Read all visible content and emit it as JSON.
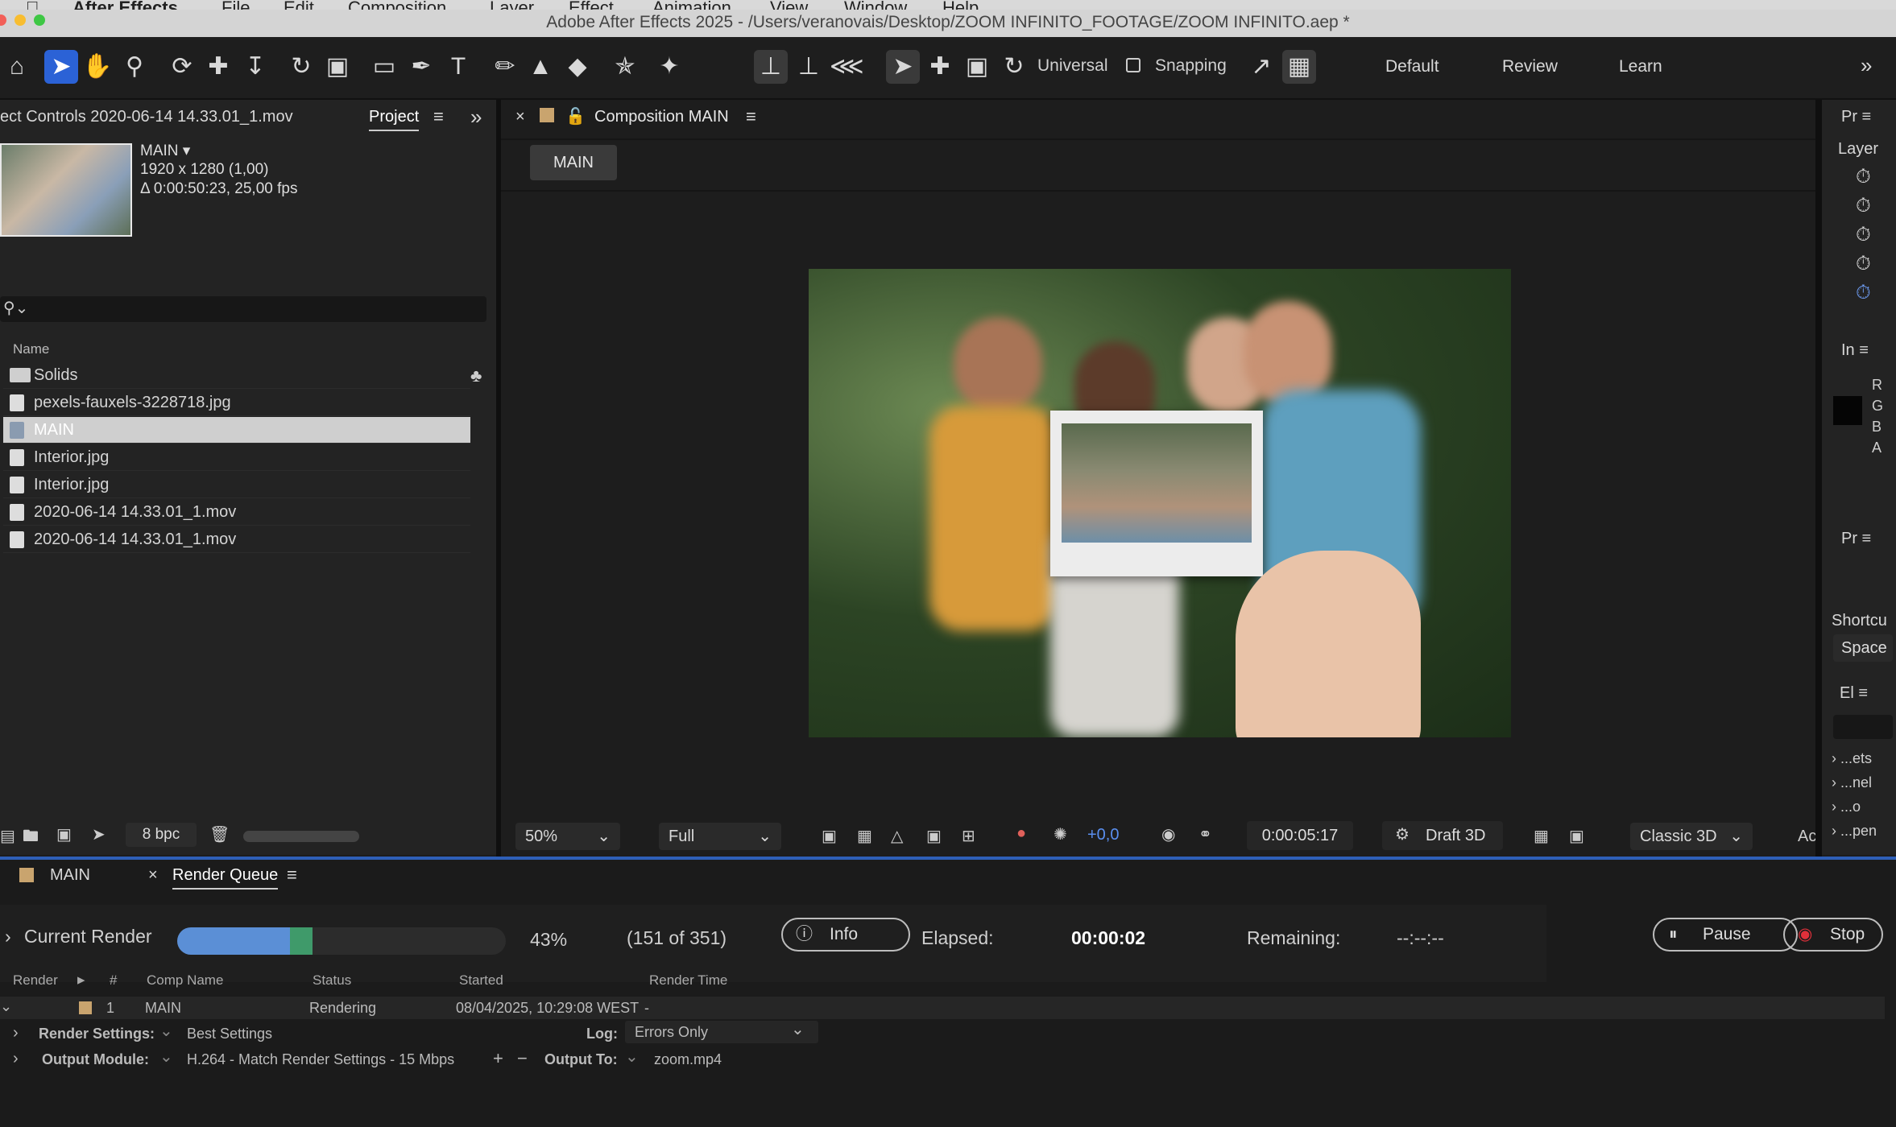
{
  "menubar": {
    "app": "After Effects",
    "items": [
      "File",
      "Edit",
      "Composition",
      "Layer",
      "Effect",
      "Animation",
      "View",
      "Window",
      "Help"
    ]
  },
  "window": {
    "title": "Adobe After Effects 2025 - /Users/veranovais/Desktop/ZOOM INFINITO_FOOTAGE/ZOOM INFINITO.aep *"
  },
  "toolbar": {
    "universal_label": "Universal",
    "snapping_label": "Snapping",
    "workspaces": [
      "Default",
      "Review",
      "Learn"
    ]
  },
  "project": {
    "effect_controls_tab": "ect Controls 2020-06-14 14.33.01_1.mov",
    "project_tab": "Project",
    "selected_name": "MAIN ▾",
    "selected_res": "1920 x 1280 (1,00)",
    "selected_dur": "Δ 0:00:50:23, 25,00 fps",
    "name_col": "Name",
    "items": [
      {
        "label": "Solids",
        "type": "folder"
      },
      {
        "label": "pexels-fauxels-3228718.jpg",
        "type": "file"
      },
      {
        "label": "MAIN",
        "type": "comp"
      },
      {
        "label": "Interior.jpg",
        "type": "file"
      },
      {
        "label": "Interior.jpg",
        "type": "file"
      },
      {
        "label": "2020-06-14 14.33.01_1.mov",
        "type": "file"
      },
      {
        "label": "2020-06-14 14.33.01_1.mov",
        "type": "file"
      }
    ],
    "bpc": "8 bpc"
  },
  "composition": {
    "tab": "Composition MAIN",
    "breadcrumb": "MAIN",
    "zoom": "50%",
    "resolution": "Full",
    "exposure": "+0,0",
    "timecode": "0:00:05:17",
    "draft3d": "Draft 3D",
    "renderer": "Classic 3D",
    "ac": "Ac"
  },
  "right_panel": {
    "pr_label": "Pr",
    "layer_label": "Layer",
    "in_label": "In",
    "rgba": [
      "R",
      "G",
      "B",
      "A"
    ],
    "pr2_label": "Pr",
    "shortcut_label": "Shortcu",
    "space_label": "Space",
    "el_label": "El",
    "list": [
      "...ets",
      "...nel",
      "...o",
      "...pen"
    ]
  },
  "render_queue": {
    "main_tab": "MAIN",
    "tab": "Render Queue",
    "current_render": "Current Render",
    "progress": 0.43,
    "percent": "43%",
    "frames": "(151 of 351)",
    "info": "Info",
    "elapsed_label": "Elapsed:",
    "elapsed": "00:00:02",
    "remaining_label": "Remaining:",
    "remaining": "--:--:--",
    "pause": "Pause",
    "stop": "Stop",
    "columns": [
      "Render",
      "#",
      "Comp Name",
      "Status",
      "Started",
      "Render Time"
    ],
    "item": {
      "num": "1",
      "comp": "MAIN",
      "status": "Rendering",
      "started": "08/04/2025, 10:29:08 WEST",
      "render_time": "-"
    },
    "render_settings_label": "Render Settings:",
    "render_settings": "Best Settings",
    "log_label": "Log:",
    "log": "Errors Only",
    "output_module_label": "Output Module:",
    "output_module": "H.264 - Match Render Settings - 15 Mbps",
    "output_to_label": "Output To:",
    "output_to": "zoom.mp4"
  },
  "colors": {
    "accent": "#2b62d6",
    "progress": "#5b8fd6",
    "progress_done": "#3f9a6a",
    "stop": "#e0303a"
  }
}
